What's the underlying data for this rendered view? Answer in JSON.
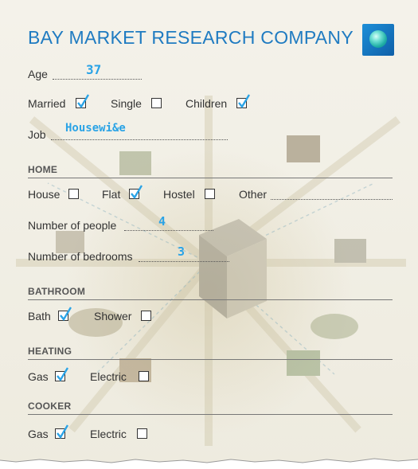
{
  "company": "BAY MARKET RESEARCH COMPANY",
  "fields": {
    "age_label": "Age",
    "age_value": "37",
    "job_label": "Job",
    "job_value": "Housewi&e",
    "people_label": "Number of people",
    "people_value": "4",
    "bedrooms_label": "Number of bedrooms",
    "bedrooms_value": "3"
  },
  "status": {
    "married_label": "Married",
    "married_checked": true,
    "single_label": "Single",
    "single_checked": false,
    "children_label": "Children",
    "children_checked": true
  },
  "sections": {
    "home": "HOME",
    "bathroom": "BATHROOM",
    "heating": "HEATING",
    "cooker": "COOKER"
  },
  "home": {
    "house_label": "House",
    "house_checked": false,
    "flat_label": "Flat",
    "flat_checked": true,
    "hostel_label": "Hostel",
    "hostel_checked": false,
    "other_label": "Other"
  },
  "bathroom": {
    "bath_label": "Bath",
    "bath_checked": true,
    "shower_label": "Shower",
    "shower_checked": false
  },
  "heating": {
    "gas_label": "Gas",
    "gas_checked": true,
    "electric_label": "Electric",
    "electric_checked": false
  },
  "cooker": {
    "gas_label": "Gas",
    "gas_checked": true,
    "electric_label": "Electric",
    "electric_checked": false
  },
  "colors": {
    "title": "#1f7bc1",
    "handwriting": "#2aa3e6",
    "tick": "#2aa3e6"
  }
}
